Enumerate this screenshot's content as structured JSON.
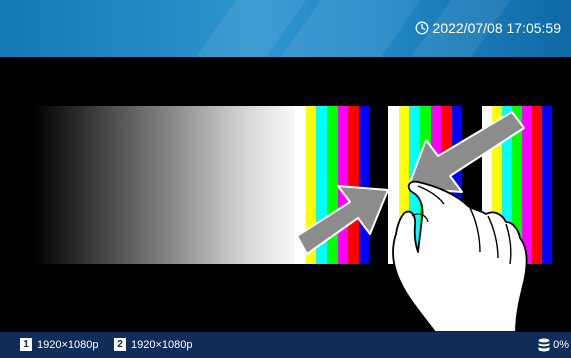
{
  "datetime": "2022/07/08 17:05:59",
  "icons": {
    "clock": "clock-icon",
    "storage": "database-icon",
    "hand": "pinch-gesture-hand-icon"
  },
  "channels": [
    {
      "number": "1",
      "resolution": "1920×1080p"
    },
    {
      "number": "2",
      "resolution": "1920×1080p"
    }
  ],
  "storage_usage": "0%",
  "colors": {
    "topbar": "#1f84c2",
    "bottombar": "#0f2c5a",
    "color_bars": [
      "#ffffff",
      "#ffff00",
      "#00ffff",
      "#00ff00",
      "#ff00ff",
      "#ff0000",
      "#0000ff",
      "#000000"
    ]
  }
}
